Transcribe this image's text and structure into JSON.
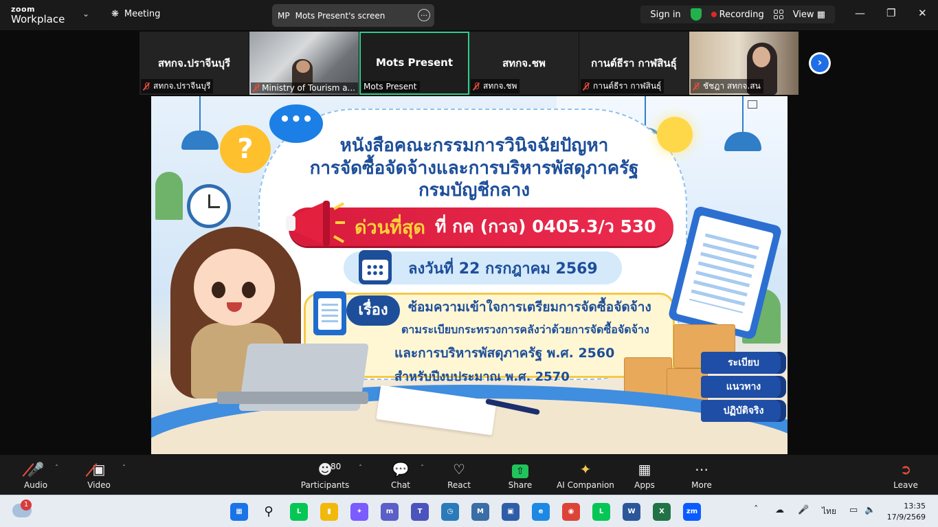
{
  "titlebar": {
    "brand_top": "zoom",
    "brand_bottom": "Workplace",
    "meeting_label": "Meeting",
    "share_initials": "MP",
    "share_title": "Mots Present's screen",
    "sign_in": "Sign in",
    "recording": "Recording",
    "view": "View"
  },
  "participants_strip": [
    {
      "big": "สทกจ.ปราจีนบุรี",
      "label": "สทกจ.ปราจีนบุรี"
    },
    {
      "big": "",
      "label": "Ministry of Tourism a..."
    },
    {
      "big": "Mots Present",
      "label": "Mots Present"
    },
    {
      "big": "สทกจ.ชพ",
      "label": "สทกจ.ชพ"
    },
    {
      "big": "กานต์ธีรา กาฬสินธุ์",
      "label": "กานต์ธีรา กาฬสินธุ์"
    },
    {
      "big": "",
      "label": "ชัชฎา สทกจ.สน"
    }
  ],
  "slide": {
    "title_line1": "หนังสือคณะกรรมการวินิจฉัยปัญหา",
    "title_line2": "การจัดซื้อจัดจ้างและการบริหารพัสดุภาครัฐ",
    "title_line3": "กรมบัญชีกลาง",
    "urgent_label": "ด่วนที่สุด",
    "urgent_ref": "ที่ กค (กวจ) 0405.3/ว 530",
    "date_text": "ลงวันที่ 22 กรกฎาคม 2569",
    "subject_tag": "เรื่อง",
    "subject_line1": "ซ้อมความเข้าใจการเตรียมการจัดซื้อจัดจ้าง",
    "subject_line2": "ตามระเบียบกระทรวงการคลังว่าด้วยการจัดซื้อจัดจ้าง",
    "subject_line3": "และการบริหารพัสดุภาครัฐ พ.ศ. 2560",
    "subject_line4": "สำหรับปีงบประมาณ พ.ศ. 2570",
    "book1": "ระเบียบ",
    "book2": "แนวทาง",
    "book3": "ปฏิบัติจริง"
  },
  "toolbar": {
    "audio": "Audio",
    "video": "Video",
    "participants": "Participants",
    "participants_count": "80",
    "chat": "Chat",
    "react": "React",
    "share": "Share",
    "ai": "AI Companion",
    "apps": "Apps",
    "more": "More",
    "leave": "Leave"
  },
  "taskbar": {
    "weather_badge": "1",
    "language": "ไทย",
    "time": "13:35",
    "date": "17/9/2569"
  },
  "colors": {
    "accent_green": "#2ecf8f",
    "recording_red": "#e02828",
    "slide_blue": "#1d4e9a",
    "urgent_red": "#d81b3c"
  }
}
